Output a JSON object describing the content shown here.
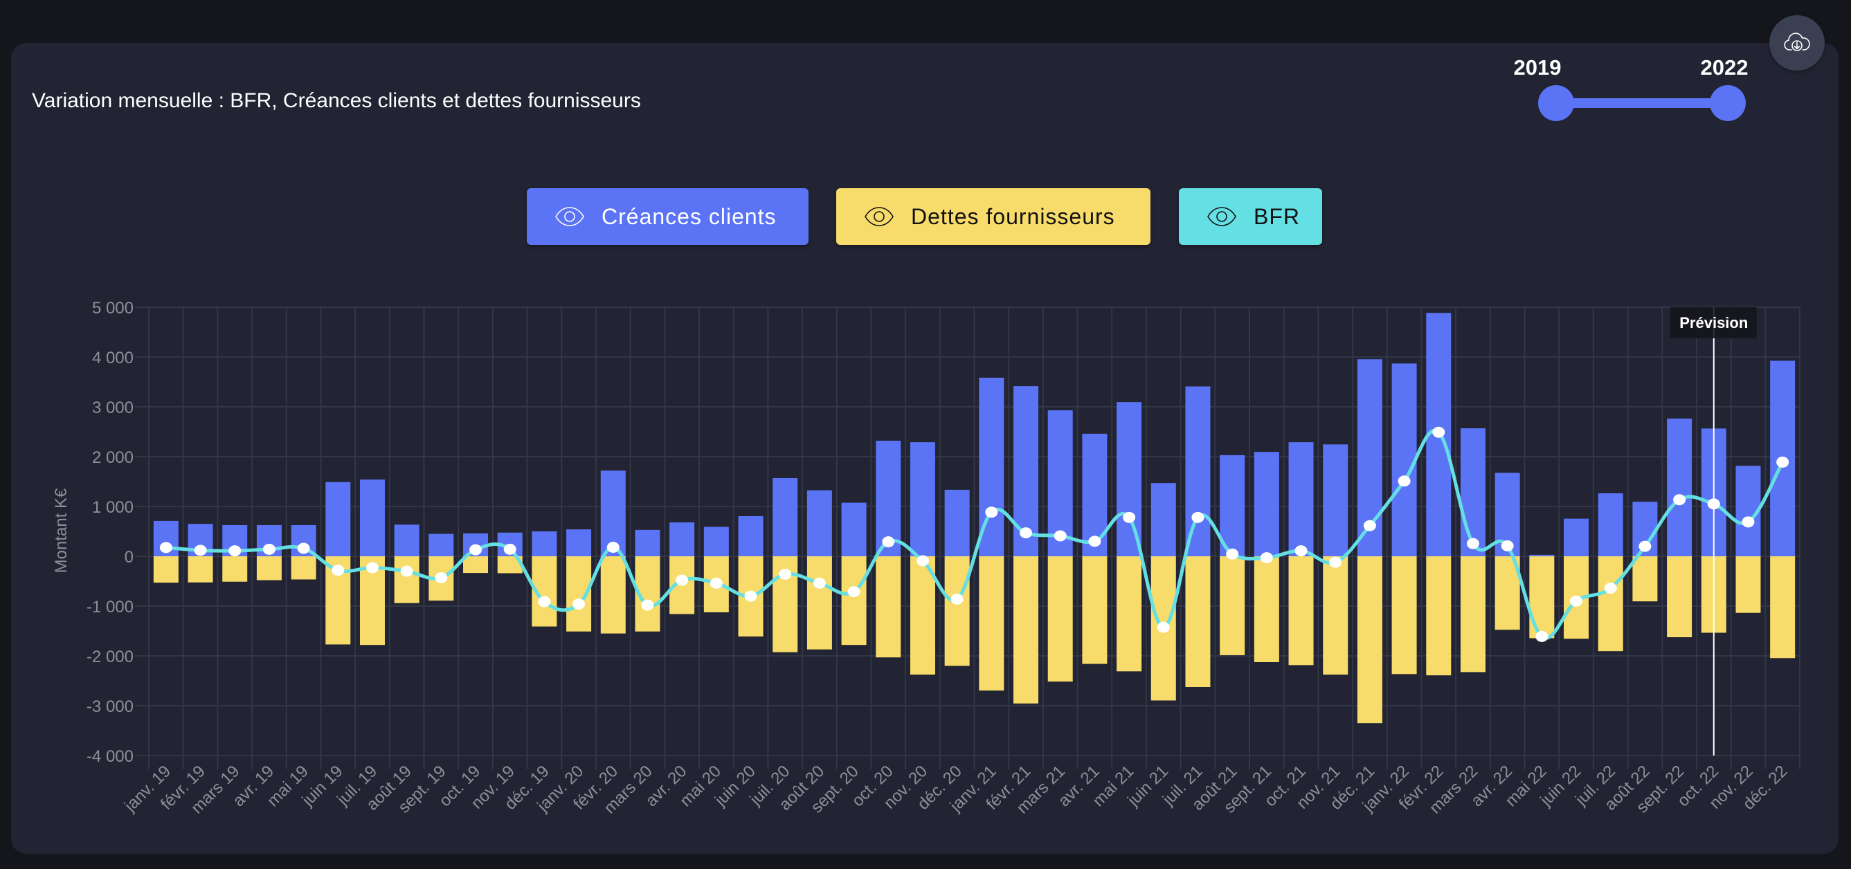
{
  "title": "Variation mensuelle : BFR, Créances clients et dettes fournisseurs",
  "download": {
    "icon": "cloud-download-icon"
  },
  "year_range": {
    "min_label": "2019",
    "max_label": "2022",
    "start": 2019,
    "end": 2022
  },
  "legend": [
    {
      "label": "Créances clients",
      "icon": "eye-icon",
      "color": "#5b73f5",
      "text_color": "#ffffff"
    },
    {
      "label": "Dettes fournisseurs",
      "icon": "eye-icon",
      "color": "#f7dc6b",
      "text_color": "#111111"
    },
    {
      "label": "BFR",
      "icon": "eye-icon",
      "color": "#64dfe3",
      "text_color": "#111111"
    }
  ],
  "chart_data": {
    "type": "bar",
    "title": "Variation mensuelle : BFR, Créances clients et dettes fournisseurs",
    "xlabel": "",
    "ylabel": "Montant K€",
    "ylim": [
      -4000,
      5000
    ],
    "yticks": [
      5000,
      4000,
      3000,
      2000,
      1000,
      0,
      -1000,
      -2000,
      -3000,
      -4000
    ],
    "ytick_labels": [
      "5 000",
      "4 000",
      "3 000",
      "2 000",
      "1 000",
      "0",
      "-1 000",
      "-2 000",
      "-3 000",
      "-4 000"
    ],
    "grid": true,
    "legend_position": "top-center",
    "categories": [
      "janv. 19",
      "févr. 19",
      "mars 19",
      "avr. 19",
      "mai 19",
      "juin 19",
      "juil. 19",
      "août 19",
      "sept. 19",
      "oct. 19",
      "nov. 19",
      "déc. 19",
      "janv. 20",
      "févr. 20",
      "mars 20",
      "avr. 20",
      "mai 20",
      "juin 20",
      "juil. 20",
      "août 20",
      "sept. 20",
      "oct. 20",
      "nov. 20",
      "déc. 20",
      "janv. 21",
      "févr. 21",
      "mars 21",
      "avr. 21",
      "mai 21",
      "juin 21",
      "juil. 21",
      "août 21",
      "sept. 21",
      "oct. 21",
      "nov. 21",
      "déc. 21",
      "janv. 22",
      "févr. 22",
      "mars 22",
      "avr. 22",
      "mai 22",
      "juin 22",
      "juil. 22",
      "août 22",
      "sept. 22",
      "oct. 22",
      "nov. 22",
      "déc. 22"
    ],
    "series": [
      {
        "name": "Créances clients",
        "type": "bar",
        "color": "#5b73f5",
        "values": [
          710,
          650,
          625,
          625,
          625,
          1490,
          1540,
          635,
          450,
          460,
          475,
          500,
          540,
          1720,
          530,
          680,
          590,
          805,
          1570,
          1325,
          1075,
          2320,
          2290,
          1335,
          3585,
          3415,
          2930,
          2460,
          3095,
          1470,
          3410,
          2030,
          2095,
          2290,
          2245,
          3955,
          3870,
          4885,
          2570,
          1675,
          30,
          755,
          1265,
          1095,
          2765,
          2565,
          1815,
          3925
        ]
      },
      {
        "name": "Dettes fournisseurs",
        "type": "bar",
        "color": "#f7dc6b",
        "values": [
          -530,
          -525,
          -510,
          -480,
          -465,
          -1770,
          -1780,
          -940,
          -890,
          -335,
          -340,
          -1410,
          -1510,
          -1550,
          -1510,
          -1160,
          -1125,
          -1610,
          -1925,
          -1870,
          -1780,
          -2030,
          -2375,
          -2200,
          -2695,
          -2955,
          -2515,
          -2160,
          -2310,
          -2895,
          -2625,
          -1985,
          -2125,
          -2185,
          -2375,
          -3350,
          -2365,
          -2390,
          -2325,
          -1475,
          -1645,
          -1655,
          -1905,
          -905,
          -1625,
          -1535,
          -1135,
          -2045
        ]
      },
      {
        "name": "BFR",
        "type": "line",
        "color": "#64dfe3",
        "values": [
          175,
          120,
          110,
          140,
          160,
          -280,
          -230,
          -300,
          -430,
          130,
          140,
          -910,
          -960,
          180,
          -980,
          -480,
          -540,
          -800,
          -360,
          -540,
          -710,
          290,
          -90,
          -860,
          885,
          470,
          410,
          300,
          780,
          -1425,
          780,
          45,
          -30,
          110,
          -120,
          615,
          1510,
          2490,
          255,
          210,
          -1610,
          -900,
          -640,
          200,
          1135,
          1050,
          690,
          1890
        ]
      }
    ],
    "annotations": [
      {
        "type": "vertical-line",
        "x": "oct. 22",
        "label": "Prévision"
      }
    ]
  }
}
